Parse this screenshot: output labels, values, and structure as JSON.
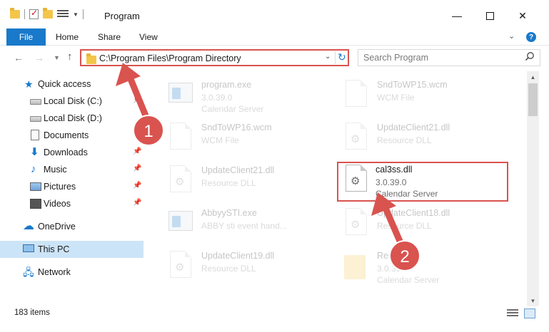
{
  "window": {
    "title": "Program"
  },
  "ribbon": {
    "file_label": "File",
    "home_label": "Home",
    "share_label": "Share",
    "view_label": "View"
  },
  "address_bar": {
    "path": "C:\\Program Files\\Program Directory"
  },
  "search": {
    "placeholder": "Search Program"
  },
  "sidebar": {
    "items": [
      {
        "label": "Quick access"
      },
      {
        "label": "Local Disk (C:)"
      },
      {
        "label": "Local Disk (D:)"
      },
      {
        "label": "Documents"
      },
      {
        "label": "Downloads"
      },
      {
        "label": "Music"
      },
      {
        "label": "Pictures"
      },
      {
        "label": "Videos"
      },
      {
        "label": "OneDrive"
      },
      {
        "label": "This PC"
      },
      {
        "label": "Network"
      }
    ]
  },
  "files": [
    {
      "name": "program.exe",
      "type": "3.0.39.0",
      "desc": "Calendar Server"
    },
    {
      "name": "SndToWP15.wcm",
      "type": "WCM File",
      "desc": ""
    },
    {
      "name": "SndToWP16.wcm",
      "type": "WCM File",
      "desc": ""
    },
    {
      "name": "UpdateClient21.dll",
      "type": "Resource DLL",
      "desc": ""
    },
    {
      "name": "UpdateClient21.dll",
      "type": "Resource DLL",
      "desc": ""
    },
    {
      "name": "cal3ss.dll",
      "type": "3.0.39.0",
      "desc": "Calendar Server"
    },
    {
      "name": "AbbyySTI.exe",
      "type": "ABBY sti event hand...",
      "desc": ""
    },
    {
      "name": "UpdateClient18.dll",
      "type": "Resource DLL",
      "desc": ""
    },
    {
      "name": "UpdateClient19.dll",
      "type": "Resource DLL",
      "desc": ""
    },
    {
      "name": "Reso",
      "type": "3.0.39.0",
      "desc": "Calendar Server"
    }
  ],
  "status": {
    "item_count": "183 items"
  },
  "annotations": {
    "step1": "1",
    "step2": "2",
    "color": "#d9534f"
  }
}
